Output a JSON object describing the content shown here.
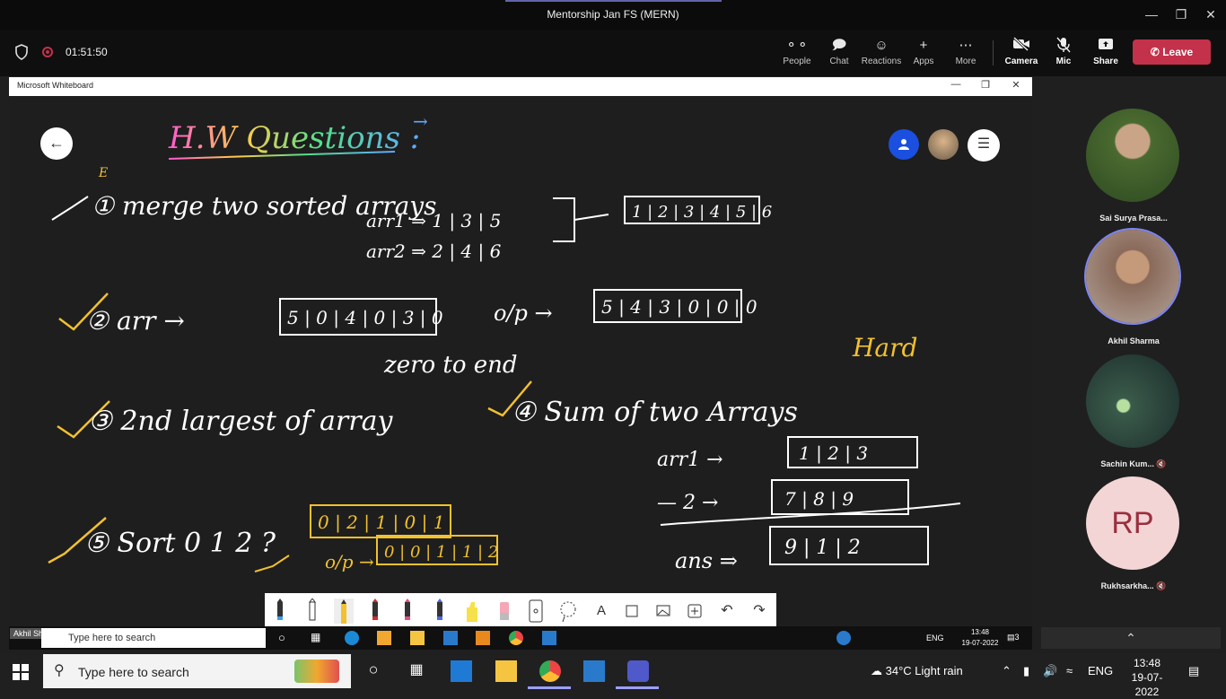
{
  "titlebar": {
    "title": "Mentorship Jan FS (MERN)"
  },
  "meeting": {
    "timer": "01:51:50",
    "controls": {
      "people": "People",
      "chat": "Chat",
      "reactions": "Reactions",
      "apps": "Apps",
      "more": "More",
      "camera": "Camera",
      "mic": "Mic",
      "share": "Share"
    },
    "leave": "Leave"
  },
  "whiteboard": {
    "window_title": "Microsoft Whiteboard",
    "heading": "H.W Questions :",
    "notes": {
      "q1": "① merge two sorted arrays",
      "arr1": "arr1 ⇒ 1 | 3 | 5",
      "arr2": "arr2 ⇒ 2 | 4 | 6",
      "q1_out": "1 | 2 | 3 | 4 | 5 | 6",
      "q2": "② arr →",
      "q2_in": "5 | 0 | 4 | 0 | 3 | 0",
      "q2_out_label": "o/p →",
      "q2_out": "5 | 4 | 3 | 0 | 0 | 0",
      "q2_caption": "zero to end",
      "q3": "③ 2nd largest of array",
      "q4": "④ Sum of two Arrays",
      "hard": "Hard",
      "q4_arr1": "arr1 →",
      "q4_arr1_vals": "1 | 2 | 3",
      "q4_arr2": "— 2 →",
      "q4_arr2_vals": "7 | 8 | 9",
      "q4_ans": "ans ⇒",
      "q4_ans_vals": "9 | 1 | 2",
      "q5": "⑤ Sort 0 1 2 ?",
      "q5_in": "0 | 2 | 1 | 0 | 1",
      "q5_out_label": "o/p →",
      "q5_out": "0 | 0 | 1 | 1 | 2"
    }
  },
  "participants": [
    {
      "name": "Sai Surya Prasa..."
    },
    {
      "name": "Akhil Sharma"
    },
    {
      "name": "Sachin Kum..."
    },
    {
      "name": "Rukhsarkha...",
      "initials": "RP"
    }
  ],
  "shared_screen": {
    "presenter": "Akhil Sharma",
    "search_placeholder": "Type here to search",
    "lang": "ENG",
    "time": "13:48",
    "date": "19-07-2022",
    "notif": "3"
  },
  "taskbar": {
    "search_placeholder": "Type here to search",
    "weather": "34°C  Light rain",
    "lang": "ENG",
    "time": "13:48",
    "date": "19-07-2022"
  },
  "colors": {
    "teams_purple": "#6264a7",
    "leave_red": "#c4314b",
    "ink_white": "#ffffff",
    "ink_yellow": "#f2c12e"
  }
}
